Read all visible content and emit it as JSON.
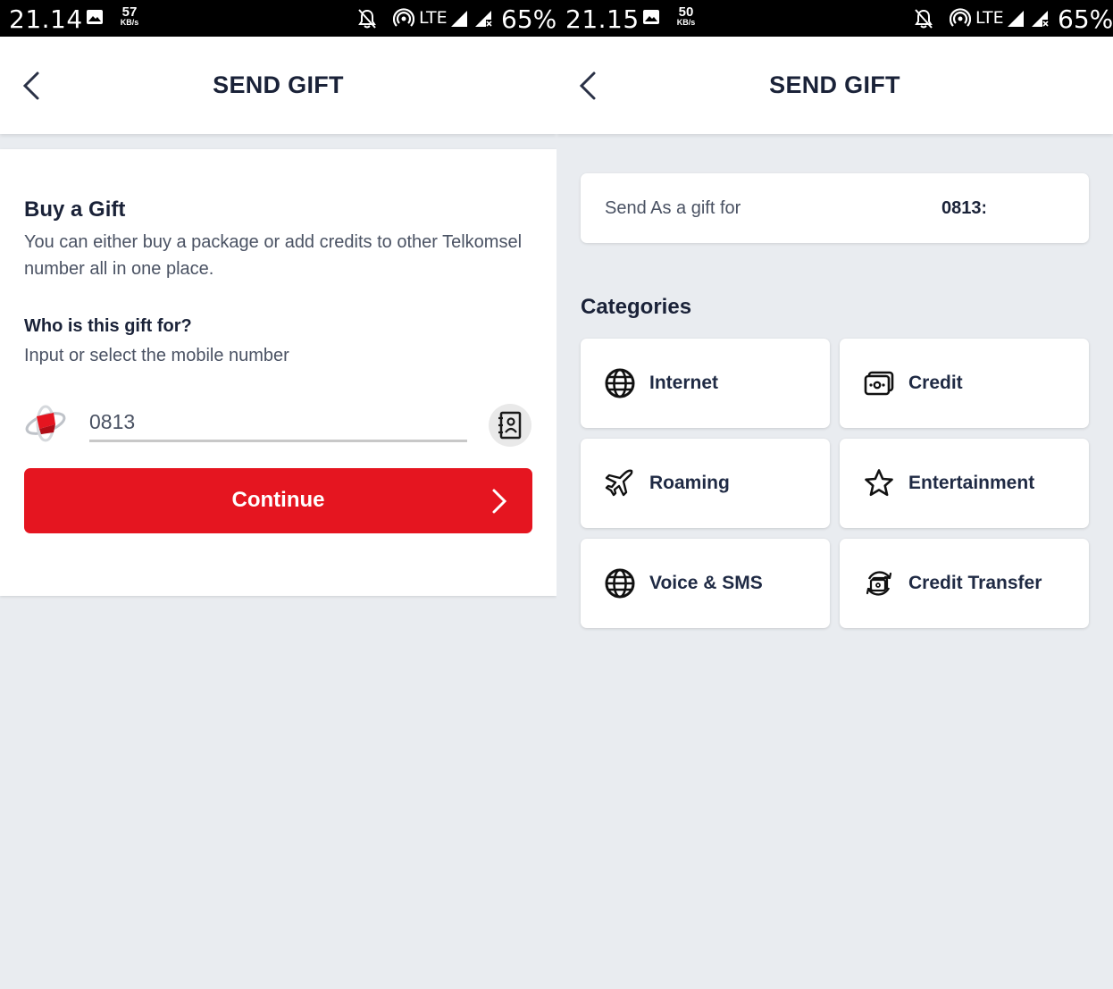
{
  "left_screen": {
    "statusbar": {
      "time": "21.14",
      "speed_value": "57",
      "speed_unit": "KB/s",
      "network": "LTE",
      "battery": "65%"
    },
    "header": {
      "title": "SEND GIFT"
    },
    "card": {
      "title": "Buy a Gift",
      "description": "You can either buy a package or add credits to other Telkomsel number all in one place.",
      "question": "Who is this gift for?",
      "hint": "Input or select the mobile number",
      "phone_value": "0813",
      "continue_label": "Continue"
    }
  },
  "right_screen": {
    "statusbar": {
      "time": "21.15",
      "speed_value": "50",
      "speed_unit": "KB/s",
      "network": "LTE",
      "battery": "65%"
    },
    "header": {
      "title": "SEND GIFT"
    },
    "gift_for": {
      "label": "Send As a gift for",
      "number": "0813:"
    },
    "categories_title": "Categories",
    "categories": [
      {
        "label": "Internet",
        "icon": "globe-icon"
      },
      {
        "label": "Credit",
        "icon": "credit-card-icon"
      },
      {
        "label": "Roaming",
        "icon": "airplane-icon"
      },
      {
        "label": "Entertainment",
        "icon": "star-icon"
      },
      {
        "label": "Voice & SMS",
        "icon": "globe-icon"
      },
      {
        "label": "Credit Transfer",
        "icon": "credit-transfer-icon"
      }
    ]
  },
  "colors": {
    "primary_red": "#e51520",
    "text_dark": "#1a2238",
    "text_muted": "#4a5263",
    "background": "#e9ecf0"
  }
}
